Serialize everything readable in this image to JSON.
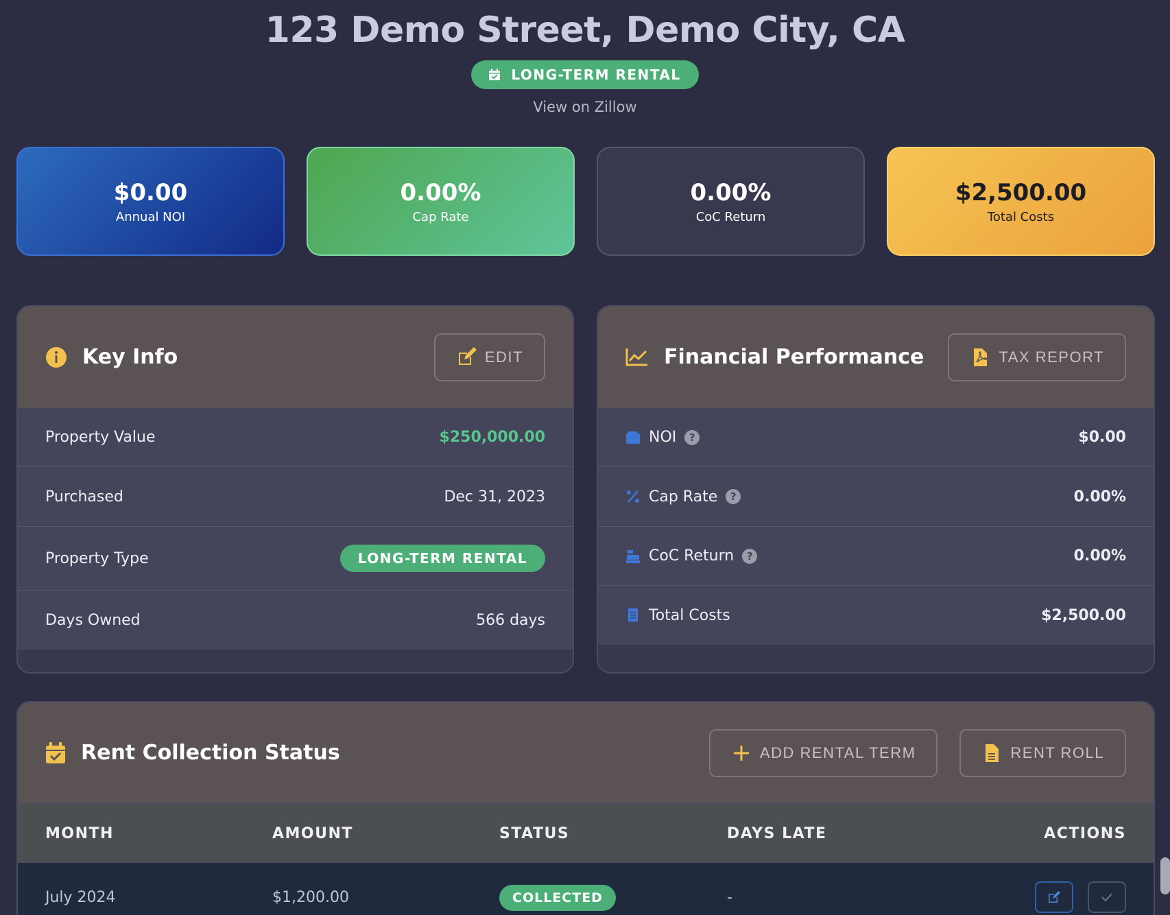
{
  "header": {
    "title": "123 Demo Street, Demo City, CA",
    "type_badge": "LONG-TERM RENTAL",
    "zillow_link": "View on Zillow"
  },
  "stats": [
    {
      "value": "$0.00",
      "label": "Annual NOI"
    },
    {
      "value": "0.00%",
      "label": "Cap Rate"
    },
    {
      "value": "0.00%",
      "label": "CoC Return"
    },
    {
      "value": "$2,500.00",
      "label": "Total Costs"
    }
  ],
  "key_info": {
    "title": "Key Info",
    "edit_label": "EDIT",
    "rows": [
      {
        "label": "Property Value",
        "value": "$250,000.00"
      },
      {
        "label": "Purchased",
        "value": "Dec 31, 2023"
      },
      {
        "label": "Property Type",
        "value": "LONG-TERM RENTAL"
      },
      {
        "label": "Days Owned",
        "value": "566 days"
      }
    ]
  },
  "financial": {
    "title": "Financial Performance",
    "tax_report_label": "TAX REPORT",
    "rows": [
      {
        "label": "NOI",
        "value": "$0.00",
        "icon": "wallet-icon"
      },
      {
        "label": "Cap Rate",
        "value": "0.00%",
        "icon": "percent-icon"
      },
      {
        "label": "CoC Return",
        "value": "0.00%",
        "icon": "cash-register-icon"
      },
      {
        "label": "Total Costs",
        "value": "$2,500.00",
        "icon": "receipt-icon"
      }
    ],
    "help_glyph": "?"
  },
  "rent": {
    "title": "Rent Collection Status",
    "add_term_label": "ADD RENTAL TERM",
    "rent_roll_label": "RENT ROLL",
    "columns": [
      "MONTH",
      "AMOUNT",
      "STATUS",
      "DAYS LATE",
      "ACTIONS"
    ],
    "rows": [
      {
        "month": "July 2024",
        "amount": "$1,200.00",
        "status": "COLLECTED",
        "days_late": "-"
      }
    ]
  },
  "colors": {
    "background": "#2c2d42",
    "accent_green": "#4caf78",
    "accent_orange": "#f6b94a",
    "icon_blue": "#3d78d8",
    "icon_gold": "#f2c14e"
  }
}
